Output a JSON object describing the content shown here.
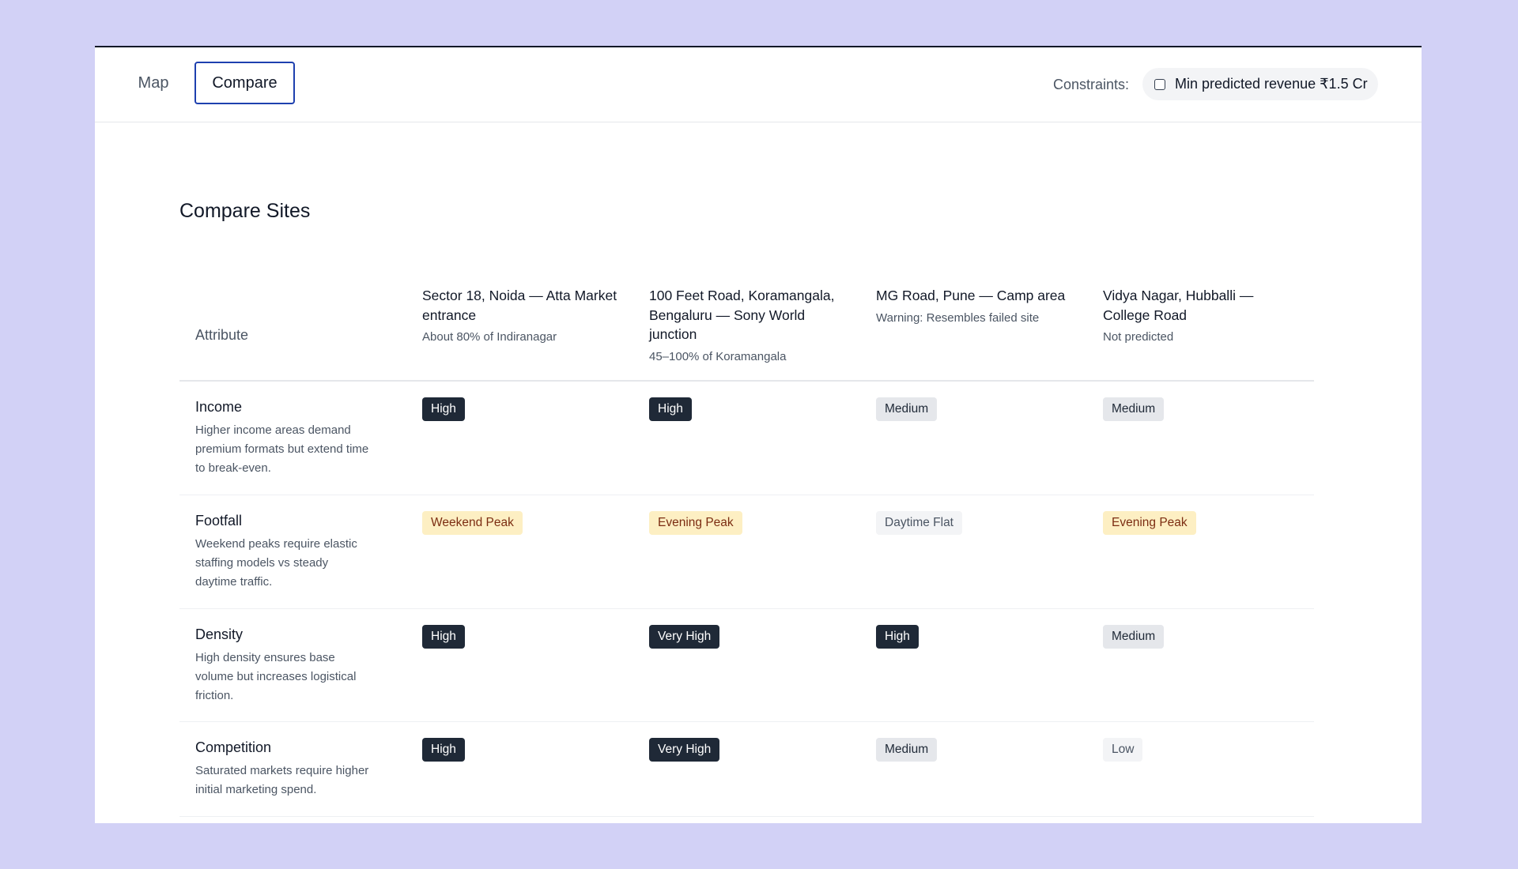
{
  "nav": {
    "tabs": [
      {
        "label": "Map",
        "active": false
      },
      {
        "label": "Compare",
        "active": true
      }
    ],
    "constraints_label": "Constraints:",
    "constraints": [
      {
        "label": "Min predicted revenue ₹1.5 Cr",
        "checked": false
      }
    ]
  },
  "page": {
    "title": "Compare Sites"
  },
  "table": {
    "attribute_header": "Attribute",
    "sites": [
      {
        "name": "Sector 18, Noida — Atta Market entrance",
        "note": "About 80% of Indiranagar"
      },
      {
        "name": "100 Feet Road, Koramangala, Bengaluru — Sony World junction",
        "note": "45–100% of Koramangala"
      },
      {
        "name": "MG Road, Pune — Camp area",
        "note": "Warning: Resembles failed site"
      },
      {
        "name": "Vidya Nagar, Hubballi — College Road",
        "note": "Not predicted"
      }
    ],
    "rows": [
      {
        "name": "Income",
        "description": "Higher income areas demand premium formats but extend time to break-even.",
        "values": [
          "High",
          "High",
          "Medium",
          "Medium"
        ],
        "styles": [
          "dark",
          "dark",
          "gray",
          "gray"
        ]
      },
      {
        "name": "Footfall",
        "description": "Weekend peaks require elastic staffing models vs steady daytime traffic.",
        "values": [
          "Weekend Peak",
          "Evening Peak",
          "Daytime Flat",
          "Evening Peak"
        ],
        "styles": [
          "amber",
          "amber",
          "light",
          "amber"
        ]
      },
      {
        "name": "Density",
        "description": "High density ensures base volume but increases logistical friction.",
        "values": [
          "High",
          "Very High",
          "High",
          "Medium"
        ],
        "styles": [
          "dark",
          "dark",
          "dark",
          "gray"
        ]
      },
      {
        "name": "Competition",
        "description": "Saturated markets require higher initial marketing spend.",
        "values": [
          "High",
          "Very High",
          "Medium",
          "Low"
        ],
        "styles": [
          "dark",
          "dark",
          "gray",
          "light"
        ]
      }
    ]
  },
  "colors": {
    "background": "#d2d1f6",
    "badge_dark": "#1f2937",
    "badge_gray": "#e5e7eb",
    "badge_amber": "#fdefc3",
    "badge_light": "#f3f4f6",
    "active_tab_border": "#1e40af"
  }
}
